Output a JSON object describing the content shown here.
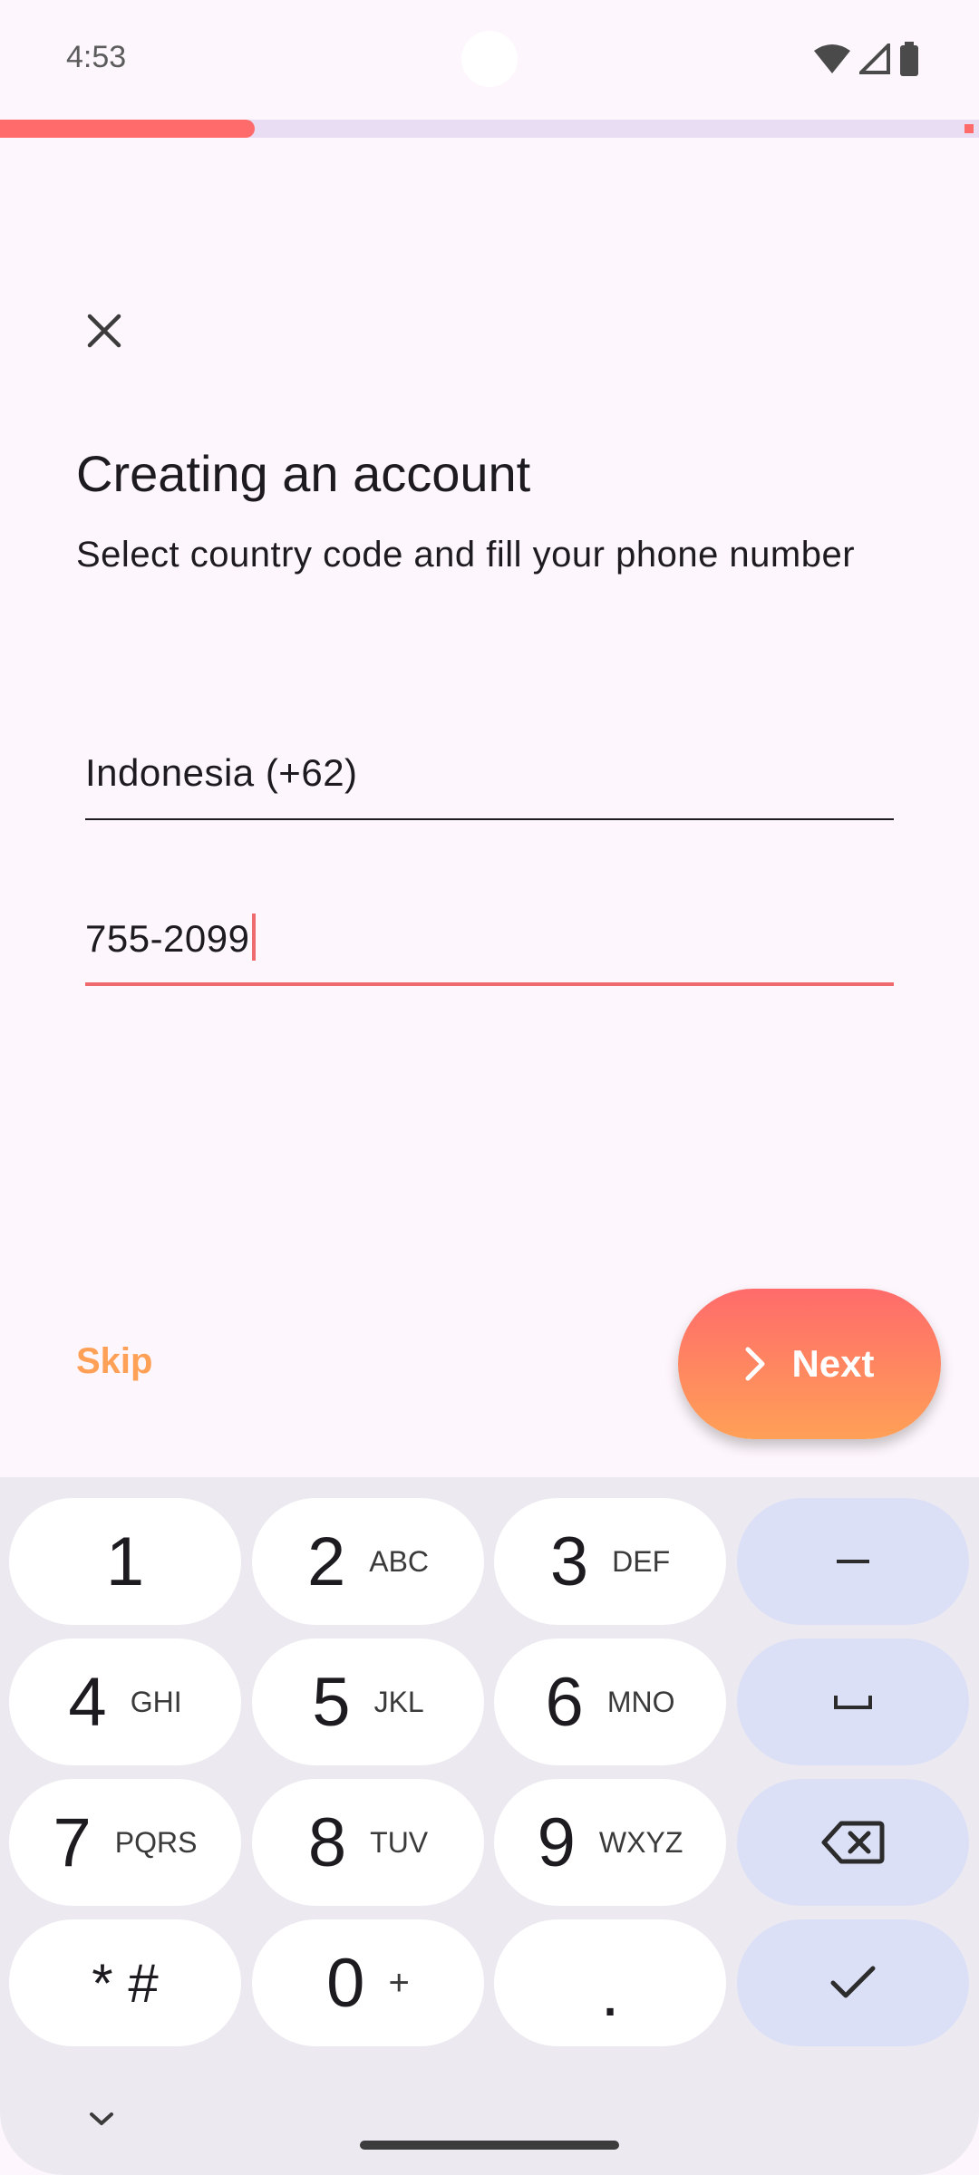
{
  "status_bar": {
    "time": "4:53"
  },
  "progress": {
    "fraction": 0.26
  },
  "header": {
    "title": "Creating an account",
    "subtitle": "Select country code and fill your phone number"
  },
  "form": {
    "country_value": "Indonesia (+62)",
    "phone_value": "755-2099"
  },
  "actions": {
    "skip_label": "Skip",
    "next_label": "Next"
  },
  "keyboard": {
    "keys": [
      {
        "main": "1",
        "sub": ""
      },
      {
        "main": "2",
        "sub": "ABC"
      },
      {
        "main": "3",
        "sub": "DEF"
      },
      {
        "main": "4",
        "sub": "GHI"
      },
      {
        "main": "5",
        "sub": "JKL"
      },
      {
        "main": "6",
        "sub": "MNO"
      },
      {
        "main": "7",
        "sub": "PQRS"
      },
      {
        "main": "8",
        "sub": "TUV"
      },
      {
        "main": "9",
        "sub": "WXYZ"
      },
      {
        "main": "* #",
        "sub": ""
      },
      {
        "main": "0",
        "sub": "+"
      },
      {
        "main": ".",
        "sub": ""
      }
    ],
    "side_keys": [
      "minus-icon",
      "space-icon",
      "backspace-icon",
      "done-check-icon"
    ]
  },
  "colors": {
    "accent": "#ff6b6b",
    "accent_orange": "#ffa057",
    "background": "#fdf6fc",
    "keyboard_bg": "#eceaf0",
    "side_key": "#dce0f7"
  }
}
